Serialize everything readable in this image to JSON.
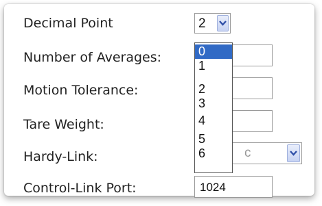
{
  "form": {
    "decimal_point": {
      "label": "Decimal Point",
      "value": "2"
    },
    "number_of_averages": {
      "label": "Number of Averages:"
    },
    "motion_tolerance": {
      "label": "Motion Tolerance:"
    },
    "tare_weight": {
      "label": "Tare Weight:"
    },
    "hardy_link": {
      "label": "Hardy-Link:",
      "value_fragment": "c"
    },
    "control_link_port": {
      "label": "Control-Link Port:",
      "value": "1024"
    }
  },
  "dropdown": {
    "options": [
      "0",
      "1",
      "2",
      "3",
      "4",
      "5",
      "6"
    ],
    "highlighted": "0"
  },
  "colors": {
    "highlight": "#316ac5",
    "arrow": "#3050a8"
  },
  "icons": {
    "select_arrow": "chevron-down-icon"
  }
}
